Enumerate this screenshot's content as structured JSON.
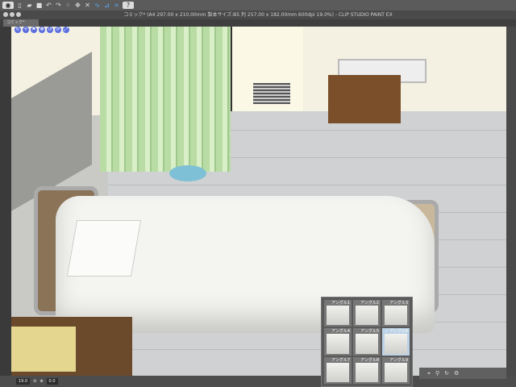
{
  "window": {
    "title": "コミック* (A4 297.00 x 210.00mm 製本サイズ:B5 判 257.00 x 182.00mm 600dpi 19.0%) - CLIP STUDIO PAINT EX"
  },
  "tab": {
    "label": "コミック*"
  },
  "toolbar": {
    "help": "?"
  },
  "status": {
    "zoom": "19.0",
    "rotation": "0.0"
  },
  "angles": [
    {
      "label": "アングル1",
      "selected": false
    },
    {
      "label": "アングル2",
      "selected": false
    },
    {
      "label": "アングル3",
      "selected": false
    },
    {
      "label": "アングル4",
      "selected": false
    },
    {
      "label": "アングル5",
      "selected": false
    },
    {
      "label": "✓ アングル6",
      "selected": true
    },
    {
      "label": "アングル7",
      "selected": false
    },
    {
      "label": "アングル8",
      "selected": false
    },
    {
      "label": "アングル9",
      "selected": false
    }
  ]
}
